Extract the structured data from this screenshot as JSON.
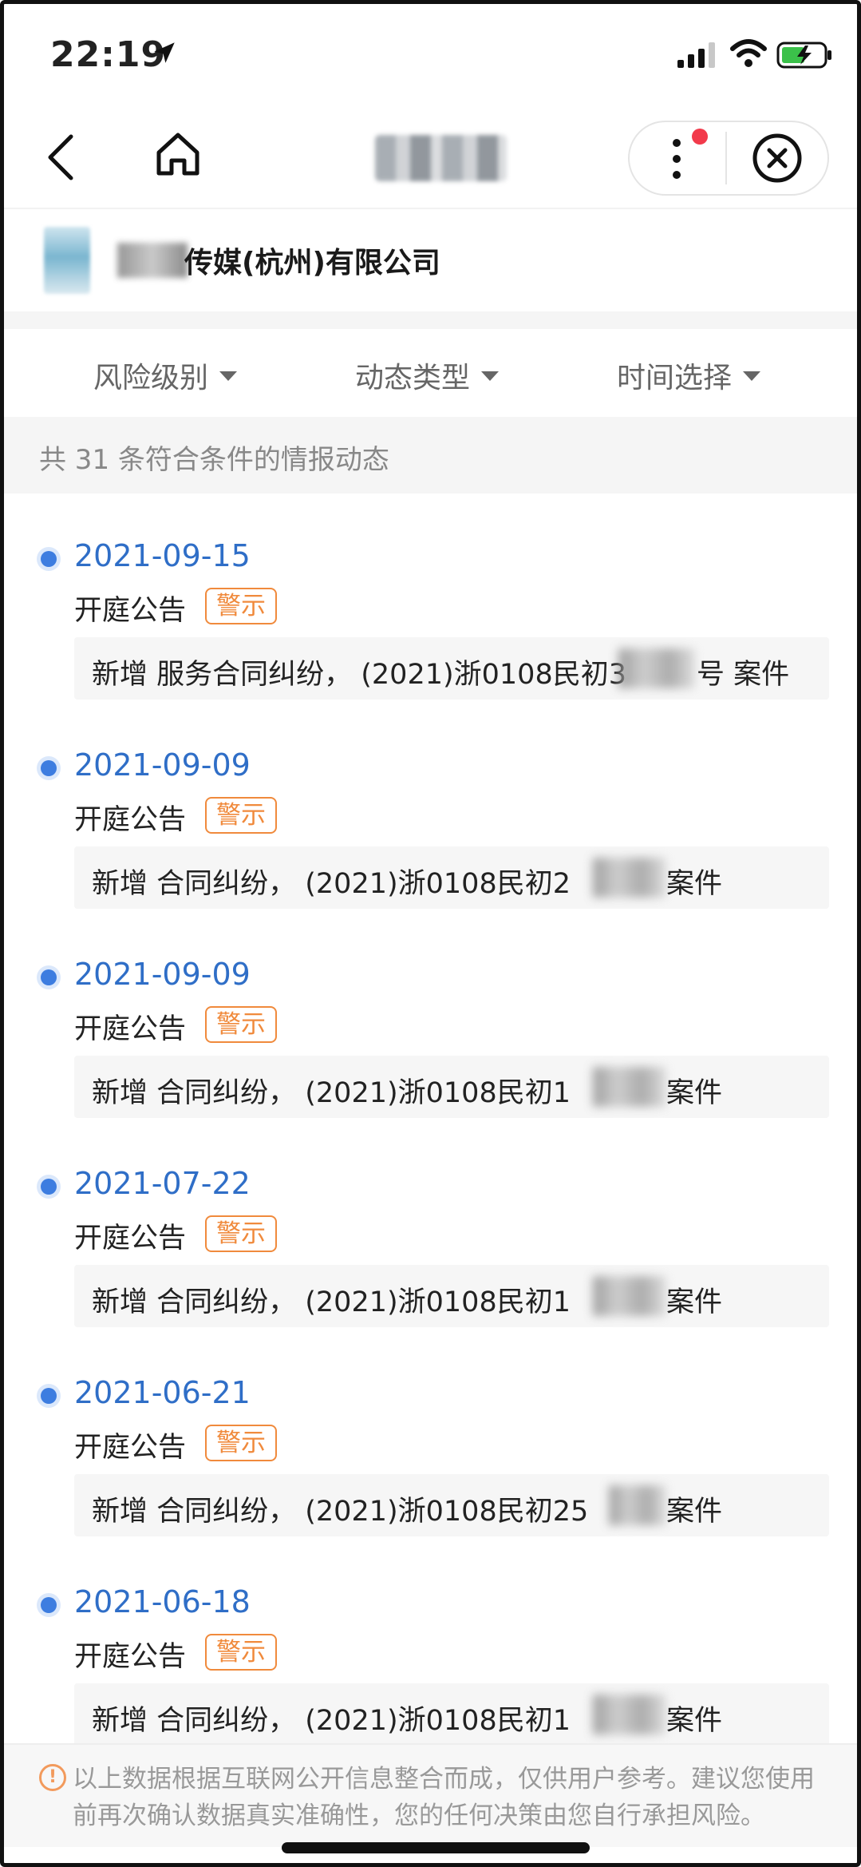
{
  "status_bar": {
    "time": "22:19"
  },
  "nav": {
    "title_blurred": true
  },
  "company": {
    "name": "传媒(杭州)有限公司"
  },
  "filters": [
    {
      "label": "风险级别"
    },
    {
      "label": "动态类型"
    },
    {
      "label": "时间选择"
    }
  ],
  "result_count_text": "共 31 条符合条件的情报动态",
  "items": [
    {
      "date": "2021-09-15",
      "type": "开庭公告",
      "badge": "警示",
      "desc_prefix": "新增 服务合同纠纷， (2021)浙0108民初3",
      "desc_suffix": "号 案件"
    },
    {
      "date": "2021-09-09",
      "type": "开庭公告",
      "badge": "警示",
      "desc_prefix": "新增 合同纠纷， (2021)浙0108民初2",
      "desc_suffix": "案件"
    },
    {
      "date": "2021-09-09",
      "type": "开庭公告",
      "badge": "警示",
      "desc_prefix": "新增 合同纠纷， (2021)浙0108民初1",
      "desc_suffix": "案件"
    },
    {
      "date": "2021-07-22",
      "type": "开庭公告",
      "badge": "警示",
      "desc_prefix": "新增 合同纠纷， (2021)浙0108民初1",
      "desc_suffix": "案件"
    },
    {
      "date": "2021-06-21",
      "type": "开庭公告",
      "badge": "警示",
      "desc_prefix": "新增 合同纠纷， (2021)浙0108民初25",
      "desc_suffix": "案件"
    },
    {
      "date": "2021-06-18",
      "type": "开庭公告",
      "badge": "警示",
      "desc_prefix": "新增 合同纠纷， (2021)浙0108民初1",
      "desc_suffix": "案件"
    }
  ],
  "notice": "以上数据根据互联网公开信息整合而成，仅供用户参考。建议您使用前再次确认数据真实准确性，您的任何决策由您自行承担风险。",
  "colors": {
    "accent_blue": "#2f6ec7",
    "warning_orange": "#f08a3c",
    "red_dot": "#f23a4b"
  }
}
